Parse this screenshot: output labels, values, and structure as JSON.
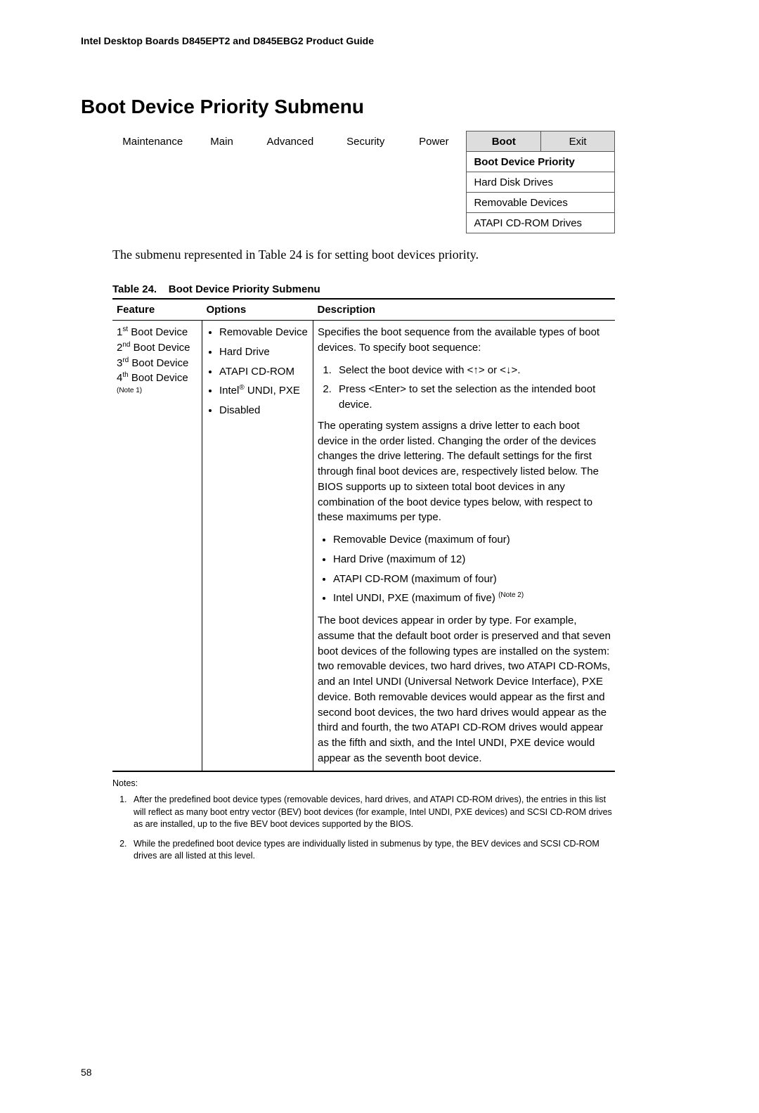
{
  "header": "Intel Desktop Boards D845EPT2 and D845EBG2 Product Guide",
  "title": "Boot Device Priority Submenu",
  "menu": {
    "tabs": [
      "Maintenance",
      "Main",
      "Advanced",
      "Security",
      "Power"
    ],
    "boot_tab": "Boot",
    "exit_tab": "Exit",
    "sub_items": [
      "Boot Device Priority",
      "Hard Disk Drives",
      "Removable Devices",
      "ATAPI CD-ROM Drives"
    ]
  },
  "intro": "The submenu represented in Table 24 is for setting boot devices priority.",
  "caption_prefix": "Table 24.",
  "caption_text": "Boot Device Priority Submenu",
  "columns": {
    "feature": "Feature",
    "options": "Options",
    "description": "Description"
  },
  "feature": {
    "f1_ord": "st",
    "f1": " Boot Device",
    "f2_ord": "nd",
    "f2": " Boot Device",
    "f3_ord": "rd",
    "f3": " Boot Device",
    "f4_ord": "th",
    "f4": " Boot Device",
    "note": "(Note 1)"
  },
  "options": {
    "o1": "Removable Device",
    "o2": "Hard Drive",
    "o3": "ATAPI CD-ROM",
    "o4_pre": "Intel",
    "o4_reg": "®",
    "o4_post": " UNDI, PXE",
    "o5": "Disabled"
  },
  "desc": {
    "p1": "Specifies the boot sequence from the available types of boot devices.  To specify boot sequence:",
    "s1": "Select the boot device with <↑> or <↓>.",
    "s2": "Press <Enter> to set the selection as the intended boot device.",
    "p2": "The operating system assigns a drive letter to each boot device in the order listed.  Changing the order of the devices changes the drive lettering.  The default settings for the first through final boot devices are, respectively listed below.  The BIOS supports up to sixteen total boot devices in any combination of the boot device types below, with respect to these maximums per type.",
    "b1": "Removable Device (maximum of four)",
    "b2": "Hard Drive (maximum of 12)",
    "b3": "ATAPI CD-ROM (maximum of four)",
    "b4_pre": "Intel UNDI, PXE (maximum of five) ",
    "b4_note": "(Note 2)",
    "p3": "The boot devices appear in order by type.  For example, assume that the default boot order is preserved and that seven boot devices of the following types are installed on the system:  two removable devices, two hard drives, two ATAPI CD-ROMs, and an Intel UNDI (Universal Network Device Interface), PXE device.  Both removable devices would appear as the first and second boot devices, the two hard drives would appear as the third and fourth, the two ATAPI CD-ROM drives would appear as the fifth and sixth, and the Intel UNDI, PXE device would appear as the seventh boot device."
  },
  "notes": {
    "label": "Notes:",
    "n1": "After the predefined boot device types (removable devices, hard drives, and ATAPI CD-ROM drives), the entries in this list will reflect as many boot entry vector (BEV) boot devices (for example, Intel UNDI, PXE devices) and SCSI CD-ROM drives as are installed, up to the five BEV boot devices supported by the BIOS.",
    "n2": "While the predefined boot device types are individually listed in submenus by type, the BEV devices and SCSI CD-ROM drives are all listed at this level."
  },
  "page_number": "58"
}
